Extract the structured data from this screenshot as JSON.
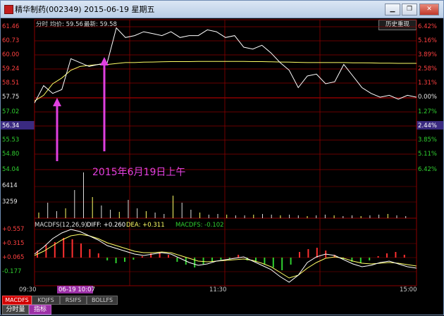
{
  "window": {
    "title": "精华制药(002349) 2015-06-19 星期五",
    "buttons": {
      "minimize": "▁",
      "restore": "❐",
      "close": "✕"
    }
  },
  "header": {
    "mode_label": "分时",
    "avg_label": "均价: 59.56",
    "latest_label": "最新: 59.58",
    "history_button": "历史重现"
  },
  "price_axis": {
    "left_labels": [
      "61.46",
      "60.73",
      "60.00",
      "59.24",
      "58.51",
      "57.75",
      "57.02",
      "56.34",
      "55.53",
      "54.80",
      "54.04"
    ],
    "right_labels": [
      "6.42%",
      "5.16%",
      "3.89%",
      "2.58%",
      "1.31%",
      "0.00%",
      "1.27%",
      "2.44%",
      "3.85%",
      "5.11%",
      "6.42%"
    ],
    "current_price": "56.34",
    "current_pct": "2.44%"
  },
  "volume_axis": {
    "labels": [
      "6414",
      "3259"
    ]
  },
  "indicator": {
    "name_params": "MACDFS(12,26,9)",
    "diff_label": "DIFF: +0.260",
    "dea_label": "DEA: +0.311",
    "macdfs_label": "MACDFS: -0.102",
    "axis_labels": [
      "+0.557",
      "+0.315",
      "+0.065",
      "-0.177"
    ]
  },
  "annotation": {
    "text": "2015年6月19日上午"
  },
  "time_axis": {
    "start": "09:30",
    "cursor_time": "06-19 10:07",
    "mid": "11:30",
    "end": "15:00"
  },
  "indicator_tabs": [
    "MACDFS",
    "KDJFS",
    "RSIFS",
    "BOLLFS"
  ],
  "bottom_tabs": [
    "分时量",
    "指标"
  ],
  "colors": {
    "price_line": "#ffffff",
    "avg_line": "#ffff66",
    "up": "#ff3030",
    "down": "#30d030",
    "grid": "#8b0000",
    "annotation": "#e040e0"
  },
  "chart_data": [
    {
      "type": "line",
      "x": [
        "09:30",
        "09:35",
        "09:40",
        "09:45",
        "09:50",
        "09:55",
        "10:00",
        "10:05",
        "10:10",
        "10:15",
        "10:20",
        "10:25",
        "10:30",
        "10:35",
        "10:40",
        "10:45",
        "10:50",
        "10:55",
        "11:00",
        "11:05",
        "11:10",
        "11:15",
        "11:20",
        "11:25",
        "11:30",
        "13:05",
        "13:10",
        "13:15",
        "13:20",
        "13:25",
        "13:30",
        "13:40",
        "13:50",
        "14:00",
        "14:10",
        "14:20",
        "14:25",
        "14:30",
        "14:35",
        "14:40",
        "14:45",
        "14:50",
        "15:00"
      ],
      "series": [
        {
          "values": [
            57.5,
            58.4,
            58.0,
            58.2,
            59.8,
            59.6,
            59.4,
            59.5,
            59.6,
            61.4,
            60.9,
            61.0,
            61.2,
            61.1,
            61.0,
            61.2,
            60.9,
            61.0,
            61.0,
            61.3,
            61.2,
            60.9,
            61.0,
            60.4,
            60.3,
            60.5,
            60.1,
            59.6,
            59.2,
            58.3,
            58.9,
            59.0,
            58.5,
            58.6,
            59.5,
            58.9,
            58.3,
            58.0,
            57.8,
            57.9,
            57.7,
            57.9,
            57.8
          ]
        },
        {
          "values": [
            57.6,
            57.9,
            58.5,
            58.8,
            59.2,
            59.4,
            59.45,
            59.5,
            59.5,
            59.55,
            59.6,
            59.6,
            59.62,
            59.63,
            59.64,
            59.65,
            59.65,
            59.65,
            59.66,
            59.66,
            59.66,
            59.66,
            59.66,
            59.66,
            59.65,
            59.65,
            59.64,
            59.63,
            59.62,
            59.61,
            59.6,
            59.6,
            59.6,
            59.6,
            59.6,
            59.59,
            59.59,
            59.58,
            59.57,
            59.57,
            59.56,
            59.56,
            59.56
          ]
        }
      ],
      "ylim": [
        54.04,
        61.46
      ]
    }
  ]
}
